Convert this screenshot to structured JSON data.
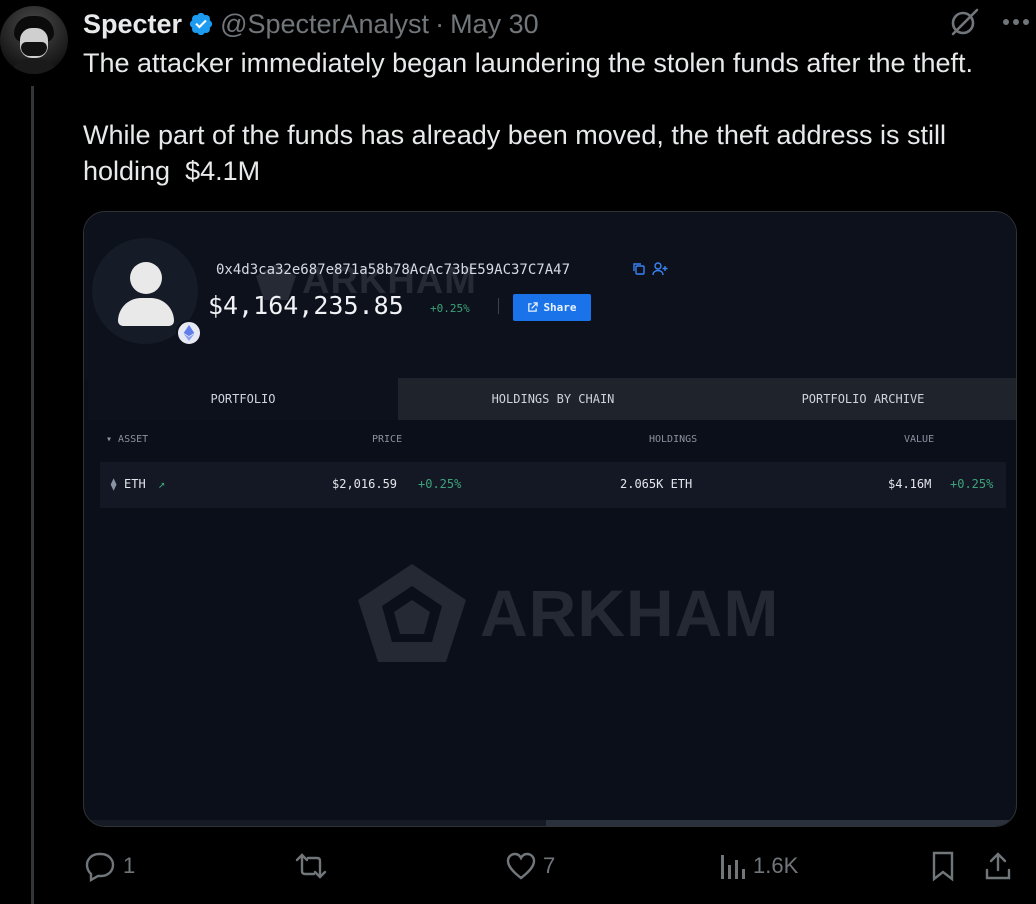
{
  "author": {
    "name": "Specter",
    "handle": "@SpecterAnalyst",
    "separator": "·",
    "date": "May 30"
  },
  "tweet": {
    "text": "The attacker immediately began laundering the stolen funds after the theft.\n\nWhile part of the funds has already been moved, the theft address is still holding  $4.1M"
  },
  "header_icons": [
    "grok-icon",
    "more-icon"
  ],
  "media": {
    "address": "0x4d3ca32e687e871a58b78AcAc73bE59AC37C7A47",
    "balance": "$4,164,235.85",
    "balance_change": "+0.25%",
    "share_label": "Share",
    "watermark": "ARKHAM",
    "tabs": [
      "PORTFOLIO",
      "HOLDINGS BY CHAIN",
      "PORTFOLIO ARCHIVE"
    ],
    "columns": {
      "asset": "ASSET",
      "price": "PRICE",
      "holdings": "HOLDINGS",
      "value": "VALUE"
    },
    "rows": [
      {
        "asset": "ETH",
        "price": "$2,016.59",
        "price_change": "+0.25%",
        "holdings": "2.065K ETH",
        "value": "$4.16M",
        "value_change": "+0.25%"
      }
    ],
    "colors": {
      "positive": "#3ea37a",
      "accent": "#1a73e8"
    }
  },
  "actions": {
    "replies": "1",
    "reposts": "",
    "likes": "7",
    "views": "1.6K"
  },
  "colors": {
    "verified": "#1d9bf0",
    "muted": "#71767b",
    "text": "#e7e9ea"
  }
}
